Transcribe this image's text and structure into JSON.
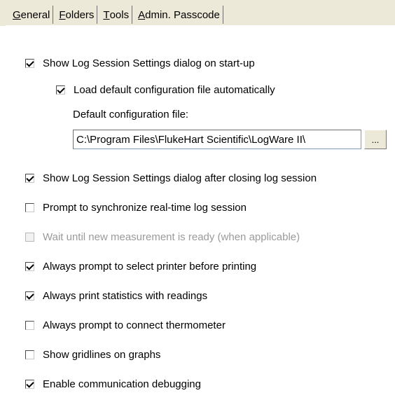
{
  "tabs": [
    {
      "label_prefix": "",
      "accel": "G",
      "label_rest": "eneral"
    },
    {
      "label_prefix": "",
      "accel": "F",
      "label_rest": "olders"
    },
    {
      "label_prefix": "",
      "accel": "T",
      "label_rest": "ools"
    },
    {
      "label_prefix": "",
      "accel": "A",
      "label_rest": "dmin. Passcode"
    }
  ],
  "settings": {
    "show_log_session_start": {
      "label": "Show Log Session Settings dialog on start-up",
      "checked": true
    },
    "load_default_config": {
      "label": "Load default configuration file automatically",
      "checked": true
    },
    "default_config_label": "Default configuration file:",
    "default_config_value": "C:\\Program Files\\FlukeHart Scientific\\LogWare II\\",
    "browse_label": "...",
    "show_log_session_after_close": {
      "label": "Show Log Session Settings dialog after closing log session",
      "checked": true
    },
    "prompt_sync_realtime": {
      "label": "Prompt to synchronize real-time log session",
      "checked": false
    },
    "wait_new_measurement": {
      "label": "Wait until new measurement is ready (when applicable)",
      "checked": false,
      "disabled": true
    },
    "prompt_select_printer": {
      "label": "Always prompt to select printer before printing",
      "checked": true
    },
    "print_statistics": {
      "label": "Always print statistics with readings",
      "checked": true
    },
    "prompt_connect_thermometer": {
      "label": "Always prompt to connect thermometer",
      "checked": false
    },
    "show_gridlines": {
      "label": "Show gridlines on graphs",
      "checked": false
    },
    "enable_comm_debug": {
      "label": "Enable communication debugging",
      "checked": true
    }
  }
}
